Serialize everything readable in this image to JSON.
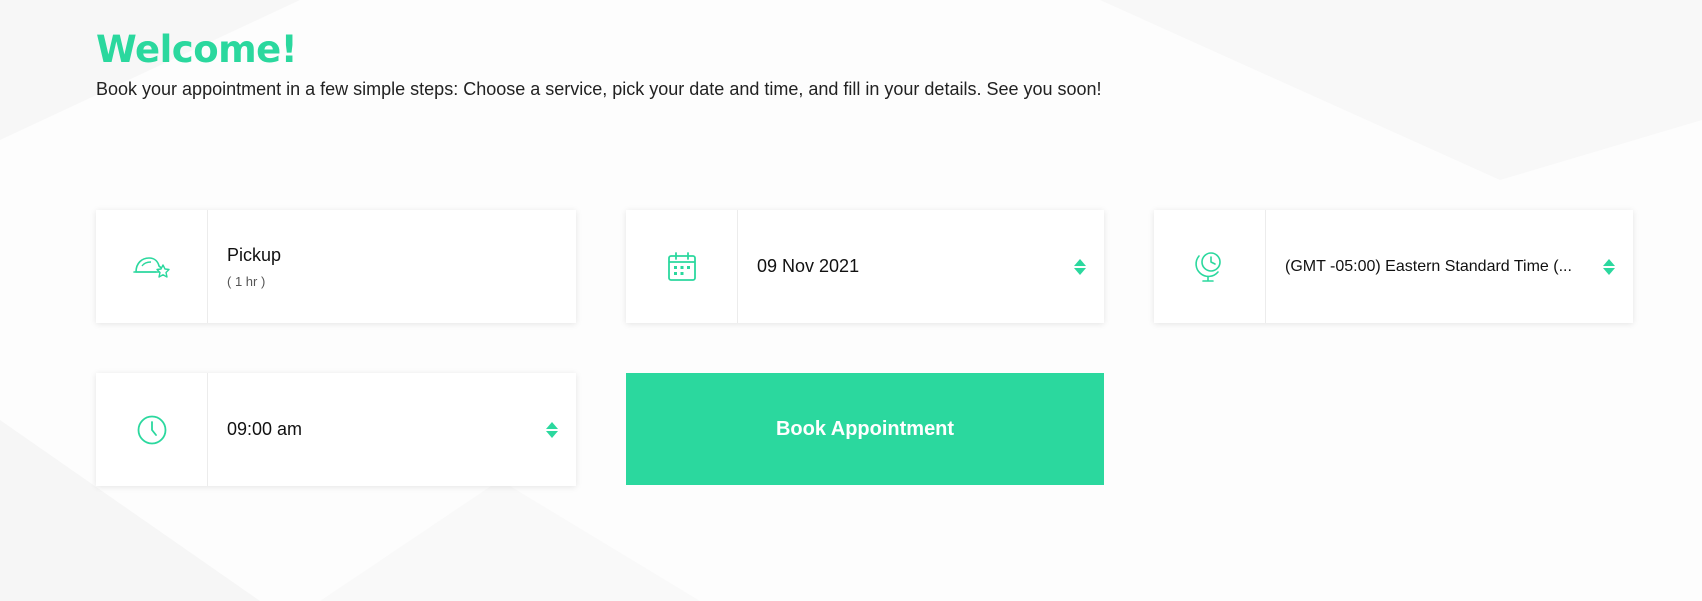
{
  "header": {
    "title": "Welcome!",
    "subtitle": "Book your appointment in a few simple steps: Choose a service, pick your date and time, and fill in your details. See you soon!"
  },
  "service": {
    "icon": "cap-star-icon",
    "name": "Pickup",
    "duration": "( 1 hr )"
  },
  "date": {
    "icon": "calendar-icon",
    "value": "09 Nov 2021"
  },
  "timezone": {
    "icon": "globe-clock-icon",
    "value": "(GMT -05:00) Eastern Standard Time (..."
  },
  "time": {
    "icon": "clock-icon",
    "value": "09:00 am"
  },
  "actions": {
    "book_label": "Book Appointment"
  },
  "colors": {
    "accent": "#2bd89e",
    "button_text": "#ffffff",
    "text": "#111111"
  }
}
